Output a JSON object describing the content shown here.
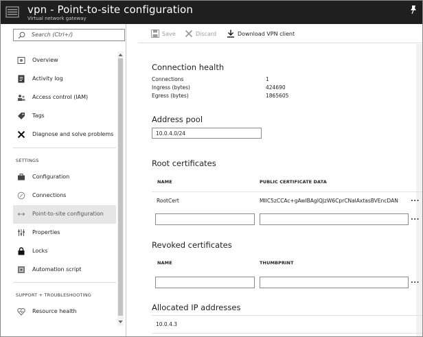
{
  "header": {
    "title": "vpn - Point-to-site configuration",
    "subtitle": "Virtual network gateway"
  },
  "sidebar": {
    "search_placeholder": "Search (Ctrl+/)",
    "items_top": [
      {
        "label": "Overview",
        "icon": "vpn-gateway-icon"
      },
      {
        "label": "Activity log",
        "icon": "activity-log-icon"
      },
      {
        "label": "Access control (IAM)",
        "icon": "people-icon"
      },
      {
        "label": "Tags",
        "icon": "tag-icon"
      },
      {
        "label": "Diagnose and solve problems",
        "icon": "wrench-icon"
      }
    ],
    "settings_label": "SETTINGS",
    "items_settings": [
      {
        "label": "Configuration",
        "icon": "briefcase-icon"
      },
      {
        "label": "Connections",
        "icon": "connections-icon"
      },
      {
        "label": "Point-to-site configuration",
        "icon": "arrows-icon",
        "selected": true
      },
      {
        "label": "Properties",
        "icon": "sliders-icon"
      },
      {
        "label": "Locks",
        "icon": "lock-icon"
      },
      {
        "label": "Automation script",
        "icon": "script-icon"
      }
    ],
    "support_label": "SUPPORT + TROUBLESHOOTING",
    "items_support": [
      {
        "label": "Resource health",
        "icon": "heart-icon"
      }
    ]
  },
  "toolbar": {
    "save_label": "Save",
    "discard_label": "Discard",
    "download_label": "Download VPN client"
  },
  "connection_health": {
    "heading": "Connection health",
    "rows": [
      {
        "key": "Connections",
        "value": "1"
      },
      {
        "key": "Ingress (bytes)",
        "value": "424690"
      },
      {
        "key": "Egress (bytes)",
        "value": "1865605"
      }
    ]
  },
  "address_pool": {
    "heading": "Address pool",
    "value": "10.0.4.0/24"
  },
  "root_certificates": {
    "heading": "Root certificates",
    "col_name": "NAME",
    "col_data": "PUBLIC CERTIFICATE DATA",
    "rows": [
      {
        "name": "RootCert",
        "data": "MIIC5zCCAc+gAwIBAgIQJzW6CprCNalAxtasBVEncDAN"
      }
    ],
    "more_label": "..."
  },
  "revoked_certificates": {
    "heading": "Revoked certificates",
    "col_name": "NAME",
    "col_thumb": "THUMBPRINT",
    "more_label": "..."
  },
  "allocated_ips": {
    "heading": "Allocated IP addresses",
    "values": [
      "10.0.4.3"
    ]
  }
}
